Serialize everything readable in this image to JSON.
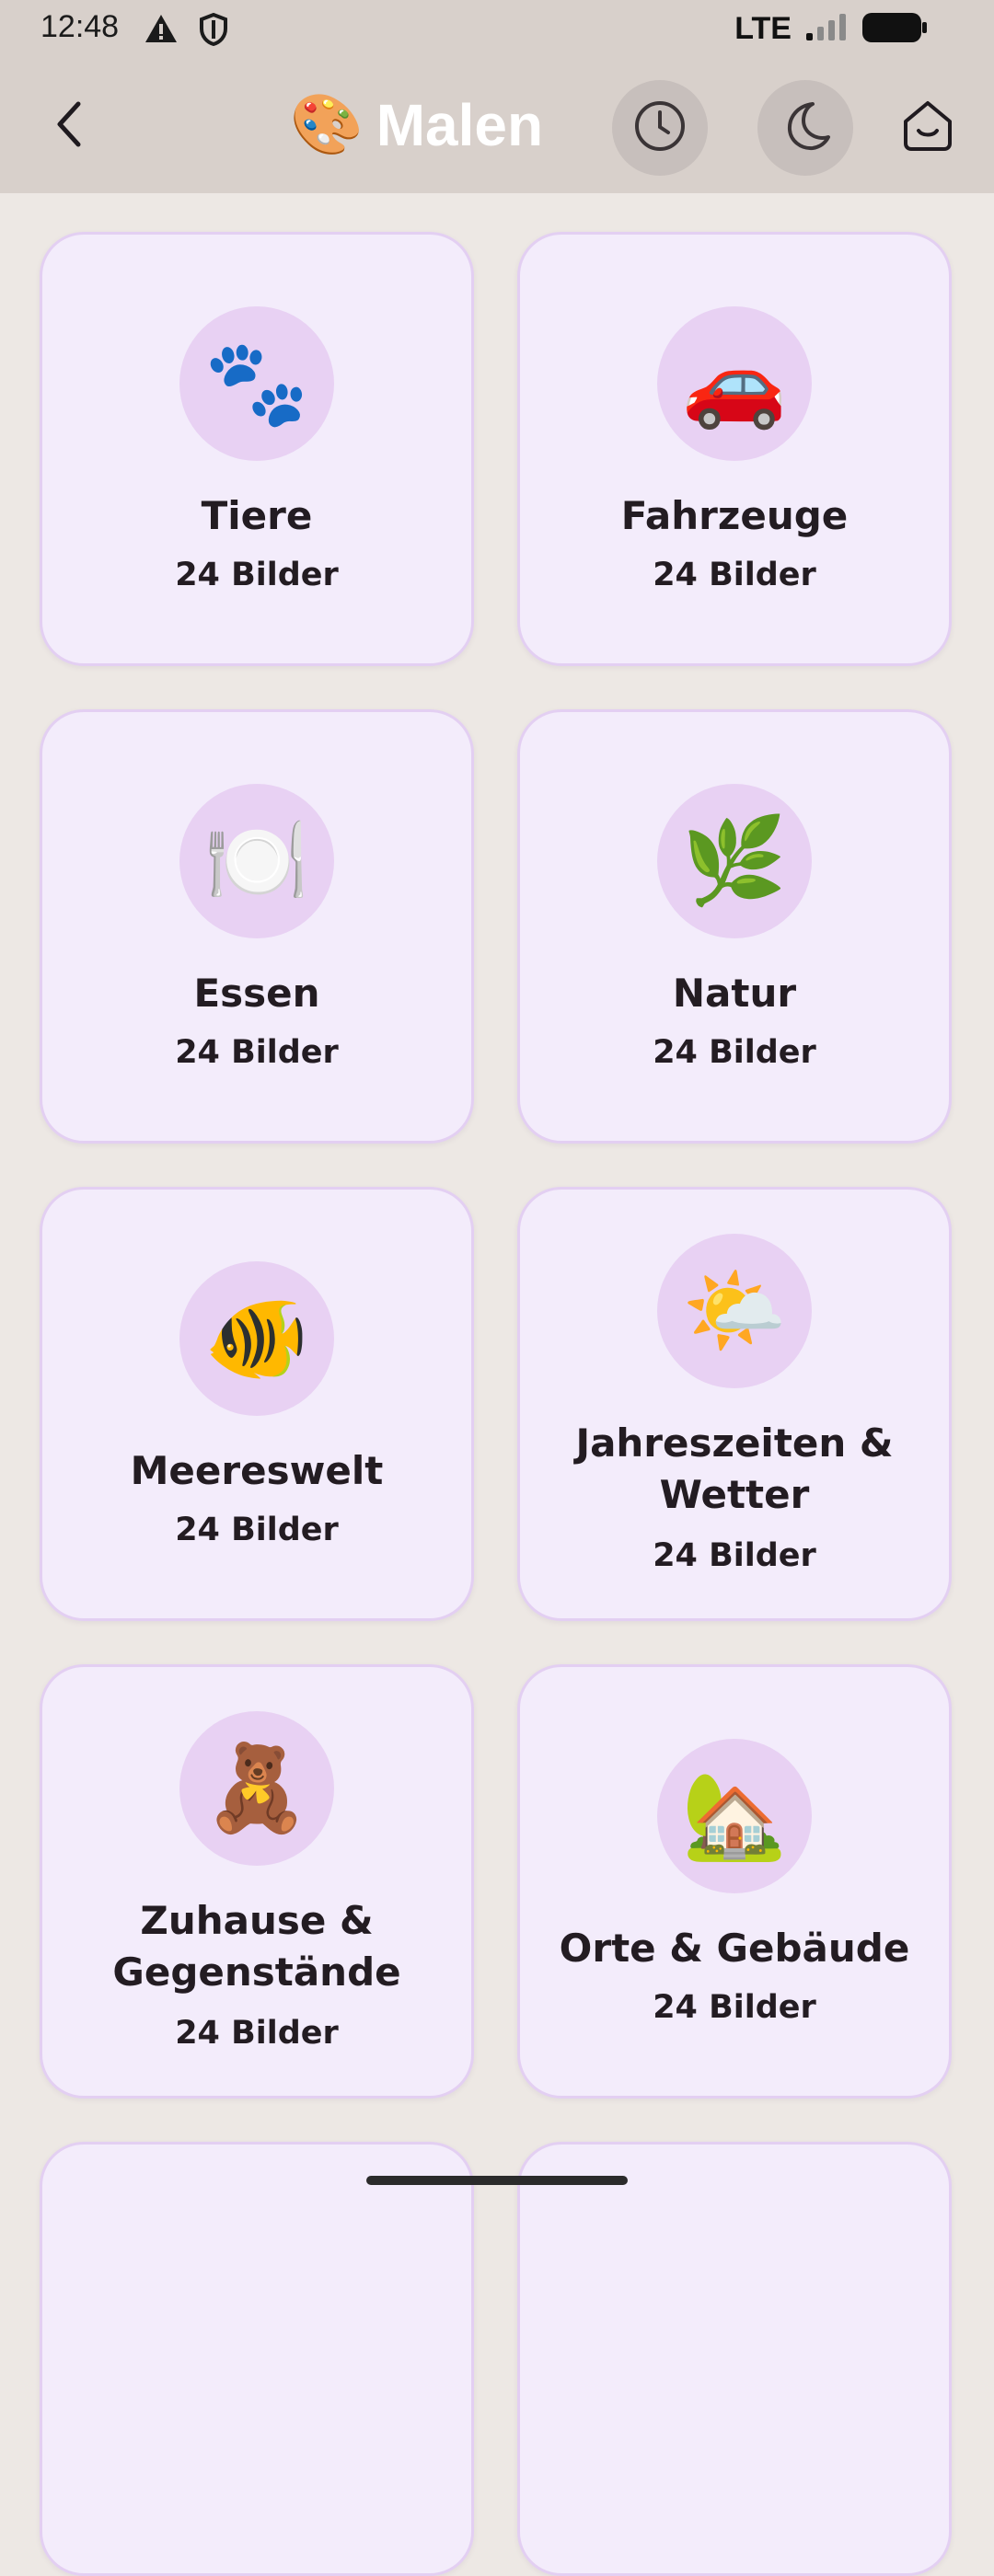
{
  "status_bar": {
    "time": "12:48",
    "network": "LTE",
    "icons": [
      "warning-icon",
      "shield-icon",
      "signal-icon",
      "battery-icon"
    ]
  },
  "header": {
    "title_emoji": "🎨",
    "title": "Malen",
    "buttons": [
      "back-icon",
      "history-clock-icon",
      "night-mode-moon-icon",
      "home-icon"
    ]
  },
  "categories": [
    {
      "emoji": "🐾",
      "title": "Tiere",
      "count": "24 Bilder"
    },
    {
      "emoji": "🚗",
      "title": "Fahrzeuge",
      "count": "24 Bilder"
    },
    {
      "emoji": "🍽️",
      "title": "Essen",
      "count": "24 Bilder"
    },
    {
      "emoji": "🌿",
      "title": "Natur",
      "count": "24 Bilder"
    },
    {
      "emoji": "🐠",
      "title": "Meereswelt",
      "count": "24 Bilder"
    },
    {
      "emoji": "🌤️",
      "title_line1": "Jahreszeiten &",
      "title_line2": "Wetter",
      "count": "24 Bilder"
    },
    {
      "emoji": "🧸",
      "title_line1": "Zuhause &",
      "title_line2": "Gegenstände",
      "count": "24 Bilder"
    },
    {
      "emoji": "🏡",
      "title": "Orte & Gebäude",
      "count": "24 Bilder"
    }
  ],
  "colors": {
    "background": "#ede8e4",
    "header": "#d8d0cb",
    "card": "#f3ecfb",
    "card_border": "#e3cff2",
    "icon_circle": "#e8d1f3"
  }
}
